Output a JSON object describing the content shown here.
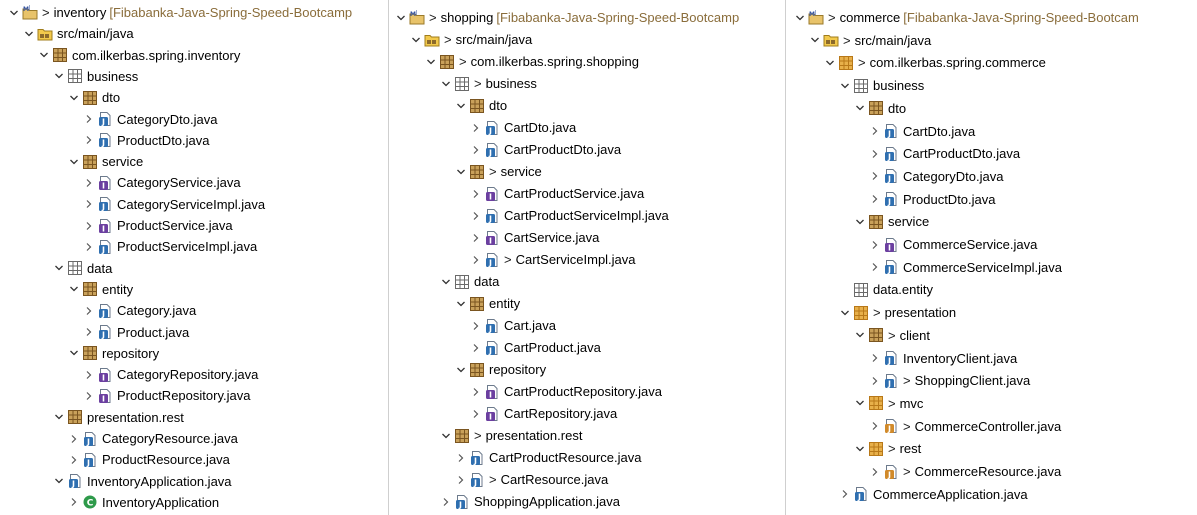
{
  "colors": {
    "decoration": "#8a6d3b",
    "packageBrown": "#8c6a2b",
    "packageOrange": "#e0a040",
    "javaBlue": "#2f6fb0",
    "interfacePurple": "#6b3fa0",
    "classGreen": "#2e9a4a"
  },
  "panels": [
    {
      "id": "inventory",
      "rows": [
        {
          "d": 0,
          "tog": "down",
          "icon": "project",
          "text": "inventory",
          "deco": true,
          "suffix": "[Fibabanka-Java-Spring-Speed-Bootcamp"
        },
        {
          "d": 1,
          "tog": "down",
          "icon": "srcfolder",
          "text": "src/main/java"
        },
        {
          "d": 2,
          "tog": "down",
          "icon": "package",
          "text": "com.ilkerbas.spring.inventory"
        },
        {
          "d": 3,
          "tog": "down",
          "icon": "package-empty",
          "text": "business"
        },
        {
          "d": 4,
          "tog": "down",
          "icon": "package",
          "text": "dto"
        },
        {
          "d": 5,
          "tog": "right",
          "icon": "javafile",
          "text": "CategoryDto.java"
        },
        {
          "d": 5,
          "tog": "right",
          "icon": "javafile",
          "text": "ProductDto.java"
        },
        {
          "d": 4,
          "tog": "down",
          "icon": "package",
          "text": "service"
        },
        {
          "d": 5,
          "tog": "right",
          "icon": "interfacefile",
          "text": "CategoryService.java"
        },
        {
          "d": 5,
          "tog": "right",
          "icon": "javafile",
          "text": "CategoryServiceImpl.java"
        },
        {
          "d": 5,
          "tog": "right",
          "icon": "interfacefile",
          "text": "ProductService.java"
        },
        {
          "d": 5,
          "tog": "right",
          "icon": "javafile",
          "text": "ProductServiceImpl.java"
        },
        {
          "d": 3,
          "tog": "down",
          "icon": "package-empty",
          "text": "data"
        },
        {
          "d": 4,
          "tog": "down",
          "icon": "package",
          "text": "entity"
        },
        {
          "d": 5,
          "tog": "right",
          "icon": "javafile",
          "text": "Category.java"
        },
        {
          "d": 5,
          "tog": "right",
          "icon": "javafile",
          "text": "Product.java"
        },
        {
          "d": 4,
          "tog": "down",
          "icon": "package",
          "text": "repository"
        },
        {
          "d": 5,
          "tog": "right",
          "icon": "interfacefile",
          "text": "CategoryRepository.java"
        },
        {
          "d": 5,
          "tog": "right",
          "icon": "interfacefile",
          "text": "ProductRepository.java"
        },
        {
          "d": 3,
          "tog": "down",
          "icon": "package",
          "text": "presentation.rest"
        },
        {
          "d": 4,
          "tog": "right",
          "icon": "javafile",
          "text": "CategoryResource.java"
        },
        {
          "d": 4,
          "tog": "right",
          "icon": "javafile",
          "text": "ProductResource.java"
        },
        {
          "d": 3,
          "tog": "down",
          "icon": "javafile",
          "text": "InventoryApplication.java"
        },
        {
          "d": 4,
          "tog": "right",
          "icon": "class",
          "text": "InventoryApplication"
        }
      ]
    },
    {
      "id": "shopping",
      "rows": [
        {
          "d": 0,
          "tog": "down",
          "icon": "project",
          "text": "shopping",
          "deco": true,
          "suffix": "[Fibabanka-Java-Spring-Speed-Bootcamp"
        },
        {
          "d": 1,
          "tog": "down",
          "icon": "srcfolder",
          "text": "src/main/java",
          "deco": true
        },
        {
          "d": 2,
          "tog": "down",
          "icon": "package",
          "text": "com.ilkerbas.spring.shopping",
          "deco": true
        },
        {
          "d": 3,
          "tog": "down",
          "icon": "package-empty",
          "text": "business",
          "deco": true
        },
        {
          "d": 4,
          "tog": "down",
          "icon": "package",
          "text": "dto"
        },
        {
          "d": 5,
          "tog": "right",
          "icon": "javafile",
          "text": "CartDto.java"
        },
        {
          "d": 5,
          "tog": "right",
          "icon": "javafile",
          "text": "CartProductDto.java"
        },
        {
          "d": 4,
          "tog": "down",
          "icon": "package",
          "text": "service",
          "deco": true
        },
        {
          "d": 5,
          "tog": "right",
          "icon": "interfacefile",
          "text": "CartProductService.java"
        },
        {
          "d": 5,
          "tog": "right",
          "icon": "javafile",
          "text": "CartProductServiceImpl.java"
        },
        {
          "d": 5,
          "tog": "right",
          "icon": "interfacefile",
          "text": "CartService.java"
        },
        {
          "d": 5,
          "tog": "right",
          "icon": "javafile",
          "text": "CartServiceImpl.java",
          "deco": true
        },
        {
          "d": 3,
          "tog": "down",
          "icon": "package-empty",
          "text": "data"
        },
        {
          "d": 4,
          "tog": "down",
          "icon": "package",
          "text": "entity"
        },
        {
          "d": 5,
          "tog": "right",
          "icon": "javafile",
          "text": "Cart.java"
        },
        {
          "d": 5,
          "tog": "right",
          "icon": "javafile",
          "text": "CartProduct.java"
        },
        {
          "d": 4,
          "tog": "down",
          "icon": "package",
          "text": "repository"
        },
        {
          "d": 5,
          "tog": "right",
          "icon": "interfacefile",
          "text": "CartProductRepository.java"
        },
        {
          "d": 5,
          "tog": "right",
          "icon": "interfacefile",
          "text": "CartRepository.java"
        },
        {
          "d": 3,
          "tog": "down",
          "icon": "package",
          "text": "presentation.rest",
          "deco": true
        },
        {
          "d": 4,
          "tog": "right",
          "icon": "javafile",
          "text": "CartProductResource.java"
        },
        {
          "d": 4,
          "tog": "right",
          "icon": "javafile",
          "text": "CartResource.java",
          "deco": true
        },
        {
          "d": 3,
          "tog": "right",
          "icon": "javafile",
          "text": "ShoppingApplication.java"
        }
      ]
    },
    {
      "id": "commerce",
      "rows": [
        {
          "d": 0,
          "tog": "down",
          "icon": "project",
          "text": "commerce",
          "deco": true,
          "suffix": "[Fibabanka-Java-Spring-Speed-Bootcam"
        },
        {
          "d": 1,
          "tog": "down",
          "icon": "srcfolder",
          "text": "src/main/java",
          "deco": true
        },
        {
          "d": 2,
          "tog": "down",
          "icon": "package-orange",
          "text": "com.ilkerbas.spring.commerce",
          "deco": true
        },
        {
          "d": 3,
          "tog": "down",
          "icon": "package-empty",
          "text": "business"
        },
        {
          "d": 4,
          "tog": "down",
          "icon": "package",
          "text": "dto"
        },
        {
          "d": 5,
          "tog": "right",
          "icon": "javafile",
          "text": "CartDto.java"
        },
        {
          "d": 5,
          "tog": "right",
          "icon": "javafile",
          "text": "CartProductDto.java"
        },
        {
          "d": 5,
          "tog": "right",
          "icon": "javafile",
          "text": "CategoryDto.java"
        },
        {
          "d": 5,
          "tog": "right",
          "icon": "javafile",
          "text": "ProductDto.java"
        },
        {
          "d": 4,
          "tog": "down",
          "icon": "package",
          "text": "service"
        },
        {
          "d": 5,
          "tog": "right",
          "icon": "interfacefile",
          "text": "CommerceService.java"
        },
        {
          "d": 5,
          "tog": "right",
          "icon": "javafile",
          "text": "CommerceServiceImpl.java"
        },
        {
          "d": 3,
          "tog": "none",
          "icon": "package-empty",
          "text": "data.entity"
        },
        {
          "d": 3,
          "tog": "down",
          "icon": "package-orange",
          "text": "presentation",
          "deco": true
        },
        {
          "d": 4,
          "tog": "down",
          "icon": "package",
          "text": "client",
          "deco": true
        },
        {
          "d": 5,
          "tog": "right",
          "icon": "javafile",
          "text": "InventoryClient.java"
        },
        {
          "d": 5,
          "tog": "right",
          "icon": "javafile",
          "text": "ShoppingClient.java",
          "deco": true
        },
        {
          "d": 4,
          "tog": "down",
          "icon": "package-orange",
          "text": "mvc",
          "deco": true
        },
        {
          "d": 5,
          "tog": "right",
          "icon": "javafile-orange",
          "text": "CommerceController.java",
          "deco": true
        },
        {
          "d": 4,
          "tog": "down",
          "icon": "package-orange",
          "text": "rest",
          "deco": true
        },
        {
          "d": 5,
          "tog": "right",
          "icon": "javafile-orange",
          "text": "CommerceResource.java",
          "deco": true
        },
        {
          "d": 3,
          "tog": "right",
          "icon": "javafile",
          "text": "CommerceApplication.java"
        }
      ]
    }
  ]
}
